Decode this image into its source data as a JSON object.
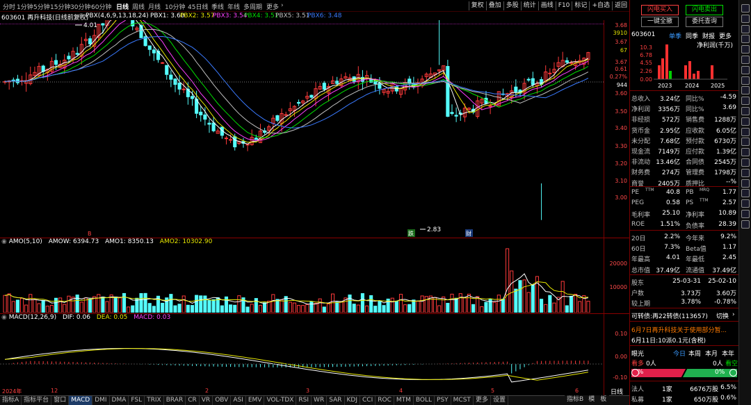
{
  "topbar": {
    "timeframes": [
      "分时",
      "1分钟",
      "5分钟",
      "15分钟",
      "30分钟",
      "60分钟",
      "日线",
      "周线",
      "月线",
      "10分钟",
      "45日线",
      "季线",
      "年线",
      "多周期",
      "更多"
    ],
    "active_index": 6,
    "right_buttons": [
      "复权",
      "叠加",
      "多股",
      "统计",
      "画线",
      "F10",
      "标记",
      "+自选",
      "返回"
    ]
  },
  "legend": {
    "stock": "603601 再升科技(日线前复权)",
    "pbx_params": "PBX(4,6,9,13,18,24)",
    "pbx1": "PBX1: 3.60",
    "pbx2": "PBX2: 3.57",
    "pbx3": "PBX3: 3.54",
    "pbx4": "PBX4: 3.51",
    "pbx5": "PBX5: 3.51",
    "pbx6": "PBX6: 3.48"
  },
  "price_axis": {
    "left": [
      "3.68",
      "3.67",
      "3.67",
      "3.60",
      "3.50",
      "3.40",
      "3.30",
      "3.20",
      "3.10",
      "3.00"
    ],
    "right": [
      "3910",
      "67"
    ],
    "change": "0.61",
    "change_pct": "0.27%",
    "vol": "944"
  },
  "annotations": {
    "high_label": "4.01",
    "low_label": "2.83",
    "marker_b": "B",
    "marker_die": "跌",
    "marker_cai": "财"
  },
  "amo": {
    "legend_name": "AMO(5,10)",
    "amow": "AMOW: 6394.73",
    "amo1": "AMO1: 8350.13",
    "amo2": "AMO2: 10302.90",
    "axis": [
      "20000",
      "10000"
    ]
  },
  "macd": {
    "legend_name": "MACD(12,26,9)",
    "dif": "DIF: 0.06",
    "dea": "DEA: 0.05",
    "macd": "MACD: 0.03",
    "axis": [
      "0.10",
      "0.00",
      "-0.10"
    ]
  },
  "xaxis": {
    "labels": [
      "2024年",
      "12",
      "2",
      "3",
      "4",
      "5",
      "6"
    ],
    "corner": "日线"
  },
  "bottom_tabs": [
    "指标A",
    "指标平台",
    "窗口",
    "MACD",
    "DMI",
    "DMA",
    "FSL",
    "TRIX",
    "BRAR",
    "CR",
    "VR",
    "OBV",
    "ASI",
    "EMV",
    "VOL-TDX",
    "RSI",
    "WR",
    "SAR",
    "KDJ",
    "CCI",
    "ROC",
    "MTM",
    "BOLL",
    "PSY",
    "MCST",
    "更多",
    "设置"
  ],
  "bottom_tabs_active": 3,
  "bottom_right_tabs": [
    "指标B",
    "模",
    "板"
  ],
  "right_panel": {
    "buy_btn": "闪电买入",
    "sell_btn": "闪电卖出",
    "cancel_btn": "一键全撤",
    "order_btn": "委托查询",
    "code": "603601",
    "tabs": [
      "单季",
      "同季",
      "财报",
      "更多"
    ],
    "profit_label": "净利润(千万)",
    "bar_axis": [
      "10.3",
      "6.78",
      "4.55",
      "2.26",
      "0.00"
    ],
    "years": [
      "2023",
      "2024",
      "2025"
    ],
    "fundamentals": [
      [
        "总收入",
        "3.24亿",
        "同比%",
        "-4.59"
      ],
      [
        "净利润",
        "3356万",
        "同比%",
        "3.69"
      ],
      [
        "非经损",
        "572万",
        "销售费",
        "1288万"
      ],
      [
        "货币金",
        "2.95亿",
        "应收款",
        "6.05亿"
      ],
      [
        "未分配",
        "7.68亿",
        "预付款",
        "6730万"
      ],
      [
        "现金流",
        "7149万",
        "应付款",
        "1.39亿"
      ],
      [
        "非流动",
        "13.46亿",
        "合同债",
        "2545万"
      ],
      [
        "财务费",
        "274万",
        "管理费",
        "1798万"
      ],
      [
        "商誉",
        "2405万",
        "质押比",
        "--%"
      ]
    ],
    "valuation": [
      [
        "PE",
        "TTM",
        "40.8",
        "PB",
        "MRQ",
        "1.77"
      ],
      [
        "PEG",
        "",
        "0.58",
        "PS",
        "TTM",
        "2.57"
      ],
      [
        "毛利率",
        "",
        "25.10",
        "净利率",
        "",
        "10.89"
      ],
      [
        "ROE",
        "",
        "1.51%",
        "负债率",
        "",
        "28.39"
      ]
    ],
    "stats": [
      [
        "20日",
        "2.2%",
        "今年来",
        "9.2%"
      ],
      [
        "60日",
        "7.3%",
        "Beta值",
        "1.17"
      ],
      [
        "年最高",
        "4.01",
        "年最低",
        "2.45"
      ],
      [
        "总市值",
        "37.49亿",
        "流通值",
        "37.49亿"
      ]
    ],
    "holders": [
      [
        "股东",
        "25-03-31",
        "25-02-10"
      ],
      [
        "户数",
        "3.73万",
        "3.60万"
      ],
      [
        "较上期",
        "3.78%",
        "-0.78%"
      ]
    ],
    "bond_text": "可转债:再22转债(113657)",
    "bond_switch": "切换",
    "news": "6月7日再升科技关于使用部分暂...",
    "dividend": "6月11日:10派0.1元(含税)",
    "vision": {
      "title": "眼光",
      "tabs": [
        "今日",
        "本周",
        "本月",
        "本年"
      ],
      "bull_label": "看多",
      "bull_val": "0人",
      "bear_val": "0人",
      "bear_label": "看空",
      "bull_pct": "0%",
      "bear_pct": "0%"
    },
    "inst": [
      [
        "法人",
        "1家",
        "6676万股",
        "6.5%"
      ],
      [
        "私募",
        "1家",
        "650万股",
        "0.6%"
      ]
    ]
  },
  "colors": {
    "up": "#ff3a3a",
    "down": "#54fcfc",
    "bg": "#000000",
    "ma1": "#ffffff",
    "ma2": "#e8e800",
    "ma3": "#ff40ff",
    "ma4": "#00e000",
    "ma5": "#c0c0c0",
    "ma6": "#3a7aff"
  }
}
